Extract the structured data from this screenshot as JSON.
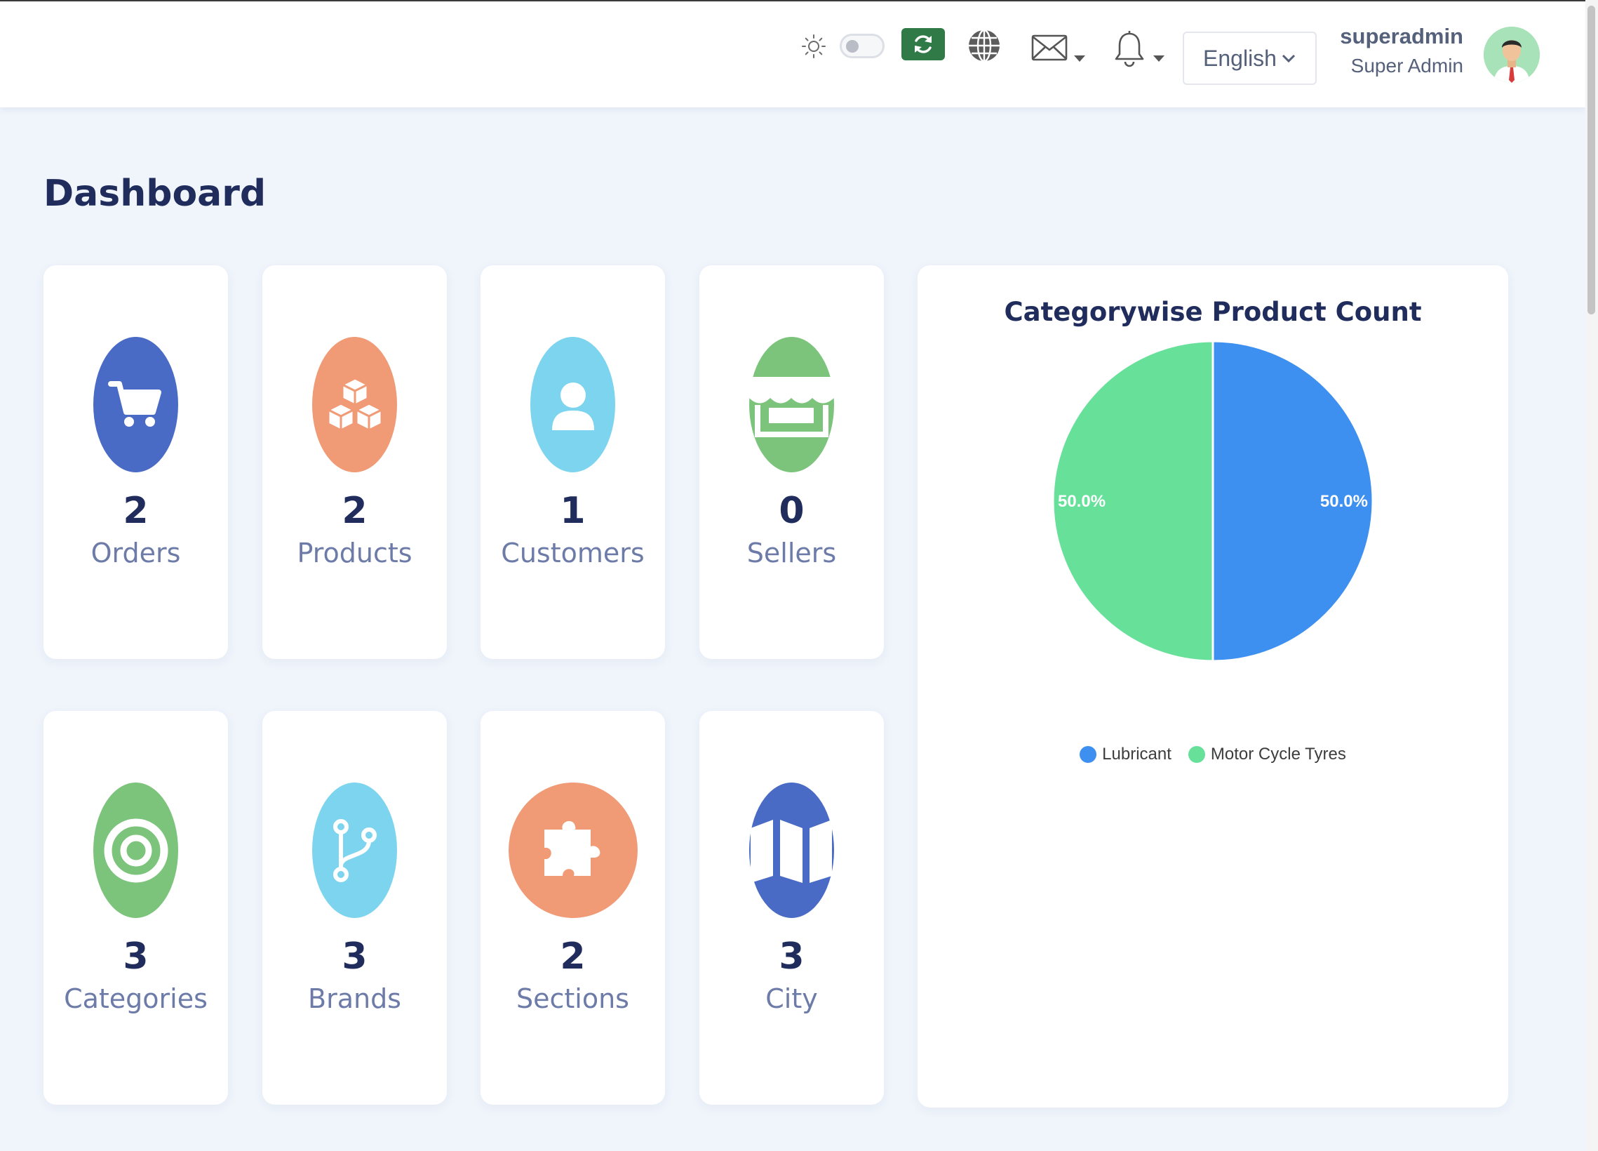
{
  "header": {
    "theme_toggle_on": false,
    "language": "English",
    "user": {
      "name": "superadmin",
      "role": "Super Admin"
    },
    "icons": [
      "sun-icon",
      "refresh-icon",
      "globe-icon",
      "envelope-icon",
      "bell-icon",
      "chevron-down-icon"
    ],
    "refresh_color": "#2f7a46"
  },
  "page": {
    "title": "Dashboard"
  },
  "stats": [
    {
      "count": "2",
      "label": "Orders",
      "color": "#4a6bc5",
      "icon": "cart-icon"
    },
    {
      "count": "2",
      "label": "Products",
      "color": "#f09a76",
      "icon": "cubes-icon"
    },
    {
      "count": "1",
      "label": "Customers",
      "color": "#7dd4ee",
      "icon": "user-icon"
    },
    {
      "count": "0",
      "label": "Sellers",
      "color": "#7cc47b",
      "icon": "store-icon"
    },
    {
      "count": "3",
      "label": "Categories",
      "color": "#7cc47b",
      "icon": "target-icon"
    },
    {
      "count": "3",
      "label": "Brands",
      "color": "#7dd4ee",
      "icon": "branch-icon"
    },
    {
      "count": "2",
      "label": "Sections",
      "color": "#f09a76",
      "icon": "puzzle-icon"
    },
    {
      "count": "3",
      "label": "City",
      "color": "#4a6bc5",
      "icon": "map-icon"
    }
  ],
  "chart_data": {
    "type": "pie",
    "title": "Categorywise Product Count",
    "categories": [
      "Lubricant",
      "Motor Cycle Tyres"
    ],
    "values": [
      1,
      1
    ],
    "labels": [
      "50.0%",
      "50.0%"
    ],
    "colors": [
      "#3d8ff0",
      "#67e09a"
    ],
    "legend_position": "bottom"
  }
}
